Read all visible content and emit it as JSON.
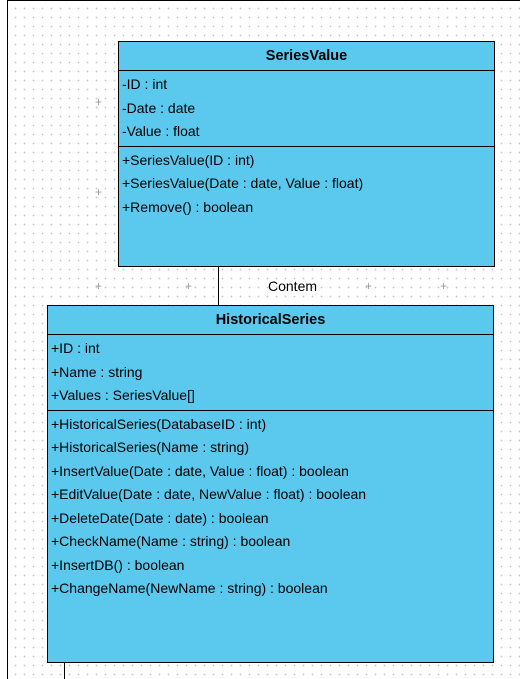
{
  "diagram": {
    "classes": [
      {
        "name": "SeriesValue",
        "attributes": [
          "-ID : int",
          "-Date : date",
          "-Value : float"
        ],
        "operations": [
          "+SeriesValue(ID : int)",
          "+SeriesValue(Date : date, Value : float)",
          "+Remove() : boolean"
        ]
      },
      {
        "name": "HistoricalSeries",
        "attributes": [
          "+ID : int",
          "+Name : string",
          "+Values : SeriesValue[]"
        ],
        "operations": [
          "+HistoricalSeries(DatabaseID : int)",
          "+HistoricalSeries(Name : string)",
          "+InsertValue(Date : date, Value : float) : boolean",
          "+EditValue(Date : date, NewValue : float) : boolean",
          "+DeleteDate(Date : date) : boolean",
          "+CheckName(Name : string) : boolean",
          "+InsertDB() : boolean",
          "+ChangeName(NewName : string) : boolean"
        ]
      }
    ],
    "association": {
      "label": "Contem"
    },
    "colors": {
      "class_fill": "#5bc8ee",
      "border": "#000000",
      "grid_dot": "#c4c4c4"
    }
  }
}
